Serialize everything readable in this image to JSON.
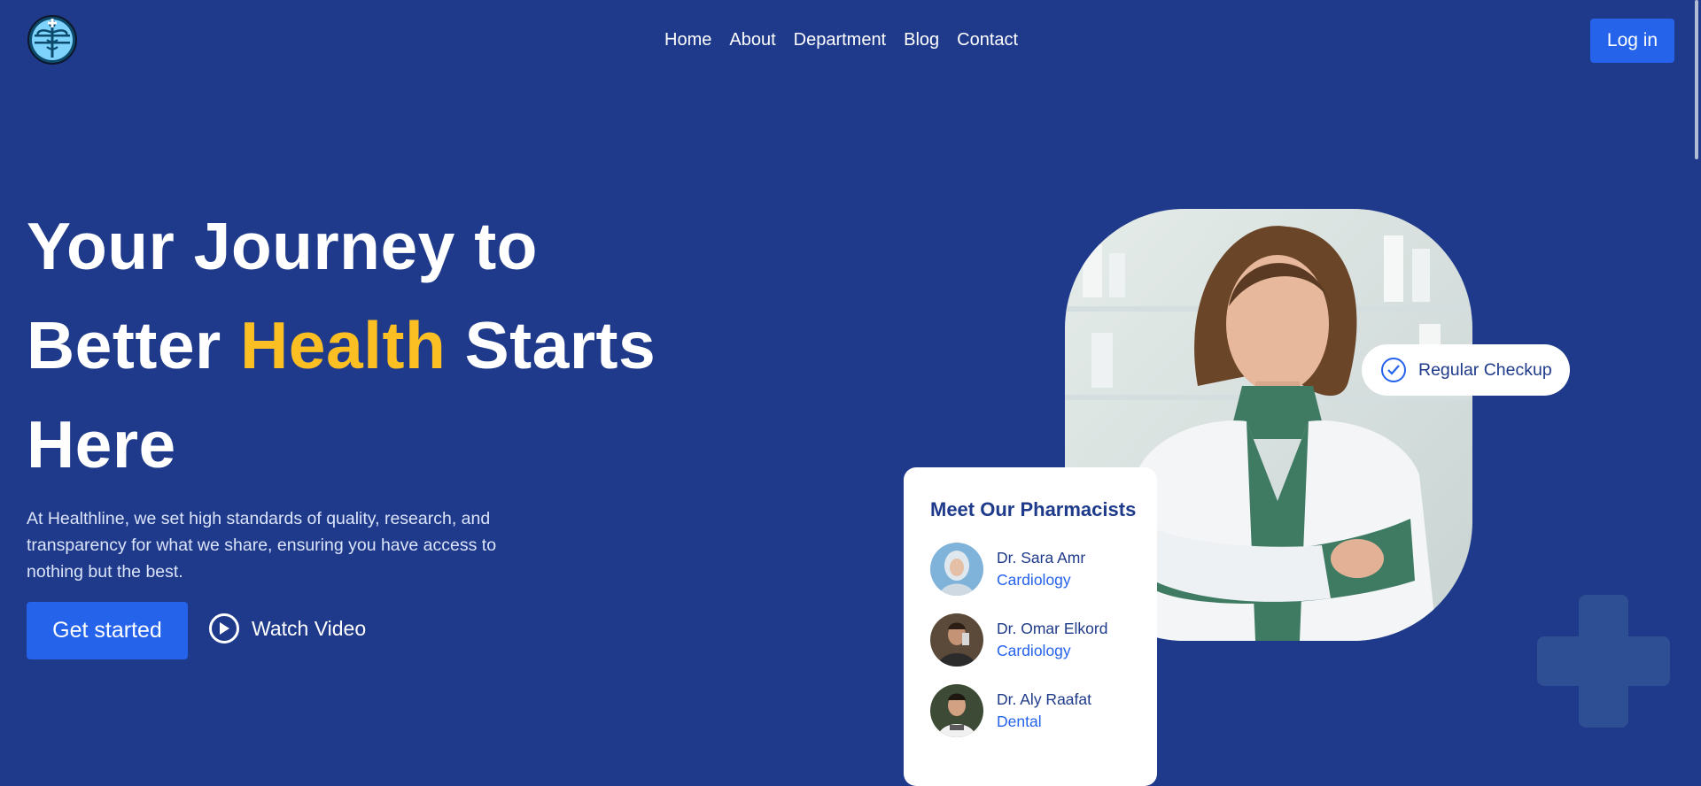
{
  "nav": {
    "items": [
      "Home",
      "About",
      "Department",
      "Blog",
      "Contact"
    ],
    "login_label": "Log in"
  },
  "hero": {
    "title_line1": "Your Journey to",
    "title_word_better": "Better",
    "title_highlight": "Health",
    "title_word_starts": "Starts",
    "title_line3": "Here",
    "description": "At Healthline, we set high standards of quality, research, and transparency for what we share, ensuring you have access to nothing but the best.",
    "cta_label": "Get started",
    "video_label": "Watch Video"
  },
  "badge": {
    "label": "Regular Checkup"
  },
  "pharmacists": {
    "title": "Meet Our Pharmacists",
    "items": [
      {
        "name": "Dr. Sara Amr",
        "specialty": "Cardiology"
      },
      {
        "name": "Dr. Omar Elkord",
        "specialty": "Cardiology"
      },
      {
        "name": "Dr. Aly Raafat",
        "specialty": "Dental"
      }
    ]
  },
  "colors": {
    "background": "#1f3a8a",
    "accent": "#2563eb",
    "highlight": "#fbbf24"
  },
  "icons": {
    "logo": "caduceus-logo-icon",
    "play": "play-icon",
    "check": "check-circle-icon",
    "decor": "plus-cross-icon"
  }
}
